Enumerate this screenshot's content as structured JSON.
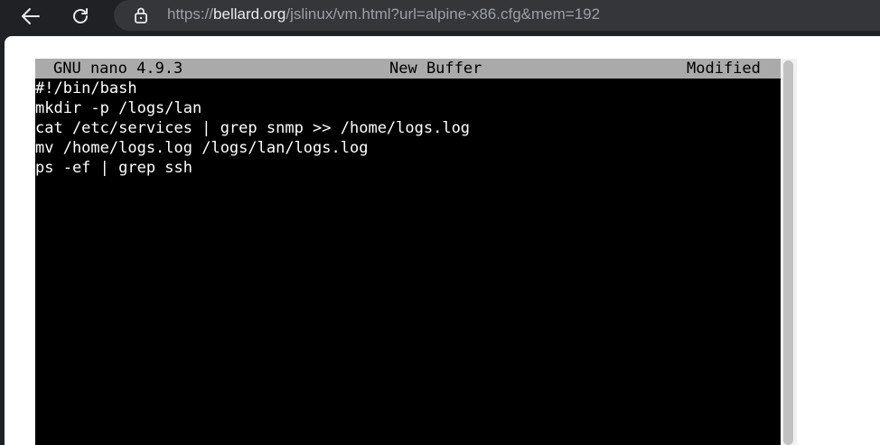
{
  "browser": {
    "url_scheme": "https://",
    "url_host": "bellard.org",
    "url_path": "/jslinux/vm.html?url=alpine-x86.cfg&mem=192"
  },
  "icons": {
    "back": "back-arrow-icon",
    "reload": "reload-icon",
    "lock": "lock-icon"
  },
  "nano": {
    "version": "GNU nano 4.9.3",
    "buffer": "New Buffer",
    "status": "Modified",
    "lines": [
      "#!/bin/bash",
      "mkdir -p /logs/lan",
      "cat /etc/services | grep snmp >> /home/logs.log",
      "mv /home/logs.log /logs/lan/logs.log",
      "ps -ef | grep ssh"
    ]
  }
}
